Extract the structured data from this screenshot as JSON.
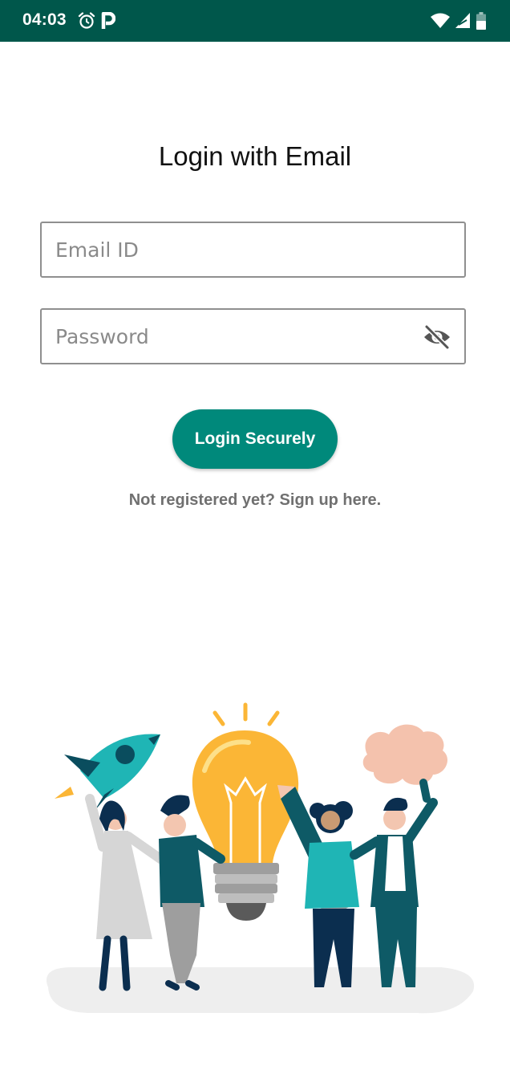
{
  "status_bar": {
    "time": "04:03",
    "icons": [
      "alarm-icon",
      "parking-app-icon",
      "wifi-icon",
      "signal-icon",
      "battery-icon"
    ],
    "background_color": "#00574b"
  },
  "login": {
    "title": "Login with Email",
    "email_placeholder": "Email ID",
    "email_value": "",
    "password_placeholder": "Password",
    "password_value": "",
    "password_toggle_icon": "eye-off-icon",
    "login_button_label": "Login Securely",
    "signup_link_text": "Not registered yet? Sign up here."
  },
  "theme": {
    "accent_color": "#00897b",
    "link_color": "#707070"
  },
  "illustration": {
    "icon": "team-ideas-illustration"
  }
}
